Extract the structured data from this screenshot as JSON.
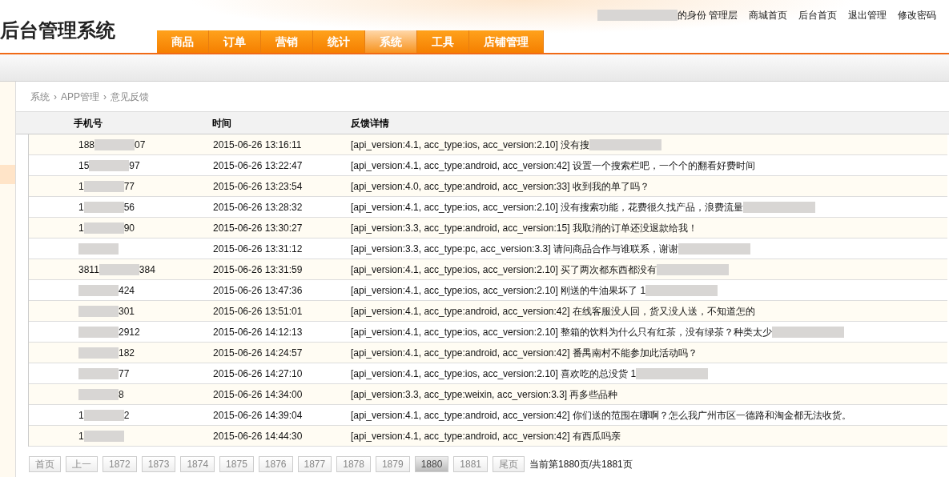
{
  "header": {
    "title": "后台管理系统",
    "user": {
      "redacted": true,
      "text": "的身份 管理层"
    },
    "links": [
      "商城首页",
      "后台首页",
      "退出管理",
      "修改密码"
    ]
  },
  "tabs": [
    {
      "label": "商品",
      "selected": false
    },
    {
      "label": "订单",
      "selected": false
    },
    {
      "label": "营销",
      "selected": false
    },
    {
      "label": "统计",
      "selected": false
    },
    {
      "label": "系统",
      "selected": true
    },
    {
      "label": "工具",
      "selected": false
    },
    {
      "label": "店铺管理",
      "selected": false
    }
  ],
  "breadcrumb": [
    "系统",
    "APP管理",
    "意见反馈"
  ],
  "breadcrumb_separator": "›",
  "table": {
    "columns": [
      "手机号",
      "时间",
      "反馈详情"
    ],
    "rows": [
      {
        "phone_start": "188",
        "phone_end": "07",
        "time": "2015-06-26 13:16:11",
        "detail": "[api_version:4.1, acc_type:ios, acc_version:2.10] 没有搜",
        "redacted": true
      },
      {
        "phone_start": "15",
        "phone_end": "97",
        "time": "2015-06-26 13:22:47",
        "detail": "[api_version:4.1, acc_type:android, acc_version:42] 设置一个搜索栏吧，一个个的翻看好费时间",
        "redacted": false
      },
      {
        "phone_start": "1",
        "phone_end": "77",
        "time": "2015-06-26 13:23:54",
        "detail": "[api_version:4.0, acc_type:android, acc_version:33] 收到我的单了吗？",
        "redacted": false
      },
      {
        "phone_start": "1",
        "phone_end": "56",
        "time": "2015-06-26 13:28:32",
        "detail": "[api_version:4.1, acc_type:ios, acc_version:2.10] 没有搜索功能，花费很久找产品，浪费流量",
        "redacted": true
      },
      {
        "phone_start": "1",
        "phone_end": "90",
        "time": "2015-06-26 13:30:27",
        "detail": "[api_version:3.3, acc_type:android, acc_version:15] 我取消的订单还没退款给我！",
        "redacted": false
      },
      {
        "phone_start": "",
        "phone_end": "",
        "time": "2015-06-26 13:31:12",
        "detail": "[api_version:3.3, acc_type:pc, acc_version:3.3] 请问商品合作与谁联系，谢谢",
        "redacted": true
      },
      {
        "phone_start": "3811",
        "phone_end": "384",
        "time": "2015-06-26 13:31:59",
        "detail": "[api_version:4.1, acc_type:ios, acc_version:2.10] 买了两次都东西都没有",
        "redacted": true
      },
      {
        "phone_start": "",
        "phone_end": "424",
        "time": "2015-06-26 13:47:36",
        "detail": "[api_version:4.1, acc_type:ios, acc_version:2.10] 刚送的牛油果坏了 1",
        "redacted": true
      },
      {
        "phone_start": "",
        "phone_end": "301",
        "time": "2015-06-26 13:51:01",
        "detail": "[api_version:4.1, acc_type:android, acc_version:42] 在线客服没人回，货又没人送，不知道怎的",
        "redacted": false
      },
      {
        "phone_start": "",
        "phone_end": "2912",
        "time": "2015-06-26 14:12:13",
        "detail": "[api_version:4.1, acc_type:ios, acc_version:2.10] 整箱的饮料为什么只有红茶，没有绿茶？种类太少",
        "redacted": true
      },
      {
        "phone_start": "",
        "phone_end": "182",
        "time": "2015-06-26 14:24:57",
        "detail": "[api_version:4.1, acc_type:android, acc_version:42] 番禺南村不能参加此活动吗？",
        "redacted": false
      },
      {
        "phone_start": "",
        "phone_end": "77",
        "time": "2015-06-26 14:27:10",
        "detail": "[api_version:4.1, acc_type:ios, acc_version:2.10] 喜欢吃的总没货 1",
        "redacted": true
      },
      {
        "phone_start": "",
        "phone_end": "8",
        "time": "2015-06-26 14:34:00",
        "detail": "[api_version:3.3, acc_type:weixin, acc_version:3.3] 再多些品种",
        "redacted": false
      },
      {
        "phone_start": "1",
        "phone_end": "2",
        "time": "2015-06-26 14:39:04",
        "detail": "[api_version:4.1, acc_type:android, acc_version:42] 你们送的范围在哪啊？怎么我广州市区一德路和淘金都无法收货。",
        "redacted": false
      },
      {
        "phone_start": "1",
        "phone_end": "",
        "time": "2015-06-26 14:44:30",
        "detail": "[api_version:4.1, acc_type:android, acc_version:42] 有西瓜吗亲",
        "redacted": false
      }
    ]
  },
  "pagination": {
    "pages": [
      {
        "label": "首页",
        "selected": false
      },
      {
        "label": "上一",
        "selected": false
      },
      {
        "label": "1872",
        "selected": false
      },
      {
        "label": "1873",
        "selected": false
      },
      {
        "label": "1874",
        "selected": false
      },
      {
        "label": "1875",
        "selected": false
      },
      {
        "label": "1876",
        "selected": false
      },
      {
        "label": "1877",
        "selected": false
      },
      {
        "label": "1878",
        "selected": false
      },
      {
        "label": "1879",
        "selected": false
      },
      {
        "label": "1880",
        "selected": true
      },
      {
        "label": "1881",
        "selected": false
      },
      {
        "label": "尾页",
        "selected": false
      }
    ],
    "summary": "当前第1880页/共1881页"
  }
}
